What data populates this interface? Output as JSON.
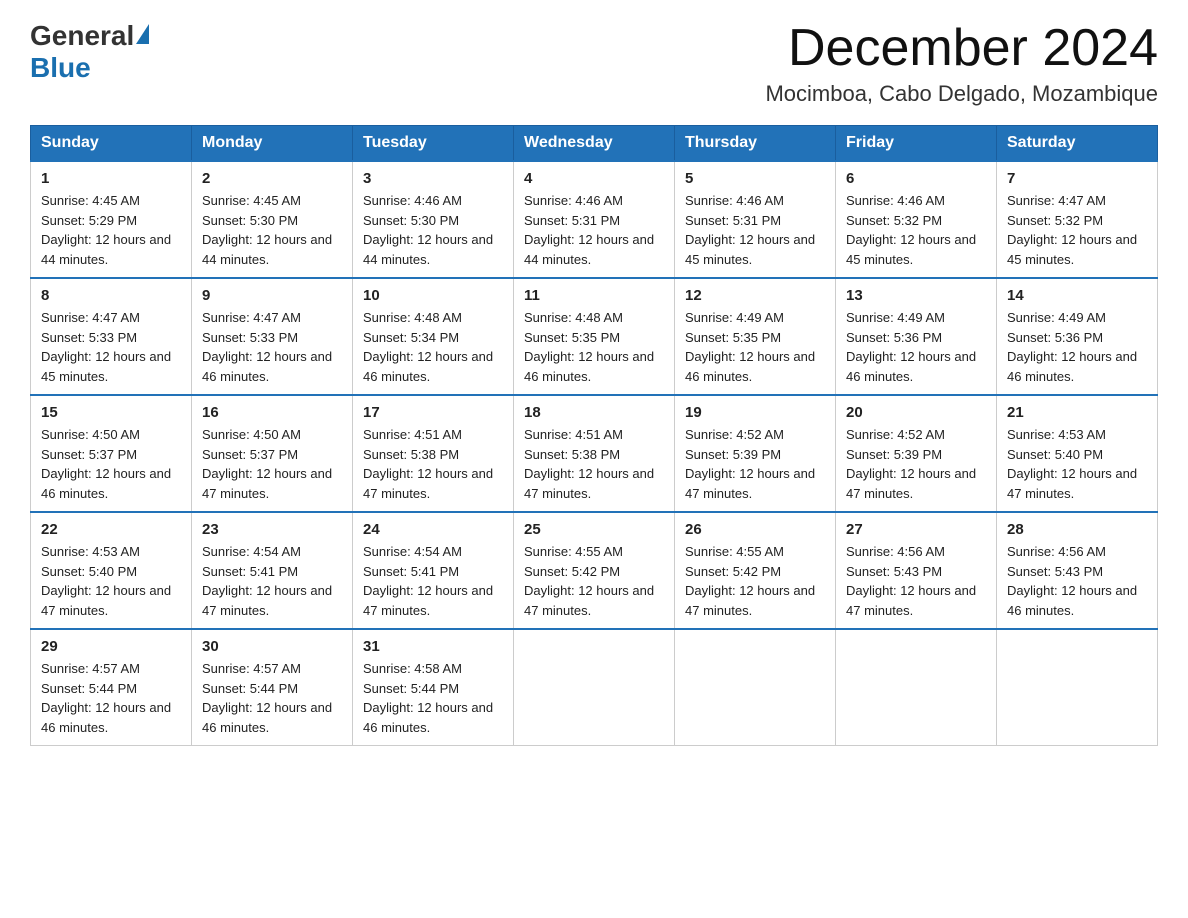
{
  "header": {
    "logo_general": "General",
    "logo_blue": "Blue",
    "month_title": "December 2024",
    "location": "Mocimboa, Cabo Delgado, Mozambique"
  },
  "weekdays": [
    "Sunday",
    "Monday",
    "Tuesday",
    "Wednesday",
    "Thursday",
    "Friday",
    "Saturday"
  ],
  "weeks": [
    [
      {
        "day": "1",
        "sunrise": "4:45 AM",
        "sunset": "5:29 PM",
        "daylight": "12 hours and 44 minutes."
      },
      {
        "day": "2",
        "sunrise": "4:45 AM",
        "sunset": "5:30 PM",
        "daylight": "12 hours and 44 minutes."
      },
      {
        "day": "3",
        "sunrise": "4:46 AM",
        "sunset": "5:30 PM",
        "daylight": "12 hours and 44 minutes."
      },
      {
        "day": "4",
        "sunrise": "4:46 AM",
        "sunset": "5:31 PM",
        "daylight": "12 hours and 44 minutes."
      },
      {
        "day": "5",
        "sunrise": "4:46 AM",
        "sunset": "5:31 PM",
        "daylight": "12 hours and 45 minutes."
      },
      {
        "day": "6",
        "sunrise": "4:46 AM",
        "sunset": "5:32 PM",
        "daylight": "12 hours and 45 minutes."
      },
      {
        "day": "7",
        "sunrise": "4:47 AM",
        "sunset": "5:32 PM",
        "daylight": "12 hours and 45 minutes."
      }
    ],
    [
      {
        "day": "8",
        "sunrise": "4:47 AM",
        "sunset": "5:33 PM",
        "daylight": "12 hours and 45 minutes."
      },
      {
        "day": "9",
        "sunrise": "4:47 AM",
        "sunset": "5:33 PM",
        "daylight": "12 hours and 46 minutes."
      },
      {
        "day": "10",
        "sunrise": "4:48 AM",
        "sunset": "5:34 PM",
        "daylight": "12 hours and 46 minutes."
      },
      {
        "day": "11",
        "sunrise": "4:48 AM",
        "sunset": "5:35 PM",
        "daylight": "12 hours and 46 minutes."
      },
      {
        "day": "12",
        "sunrise": "4:49 AM",
        "sunset": "5:35 PM",
        "daylight": "12 hours and 46 minutes."
      },
      {
        "day": "13",
        "sunrise": "4:49 AM",
        "sunset": "5:36 PM",
        "daylight": "12 hours and 46 minutes."
      },
      {
        "day": "14",
        "sunrise": "4:49 AM",
        "sunset": "5:36 PM",
        "daylight": "12 hours and 46 minutes."
      }
    ],
    [
      {
        "day": "15",
        "sunrise": "4:50 AM",
        "sunset": "5:37 PM",
        "daylight": "12 hours and 46 minutes."
      },
      {
        "day": "16",
        "sunrise": "4:50 AM",
        "sunset": "5:37 PM",
        "daylight": "12 hours and 47 minutes."
      },
      {
        "day": "17",
        "sunrise": "4:51 AM",
        "sunset": "5:38 PM",
        "daylight": "12 hours and 47 minutes."
      },
      {
        "day": "18",
        "sunrise": "4:51 AM",
        "sunset": "5:38 PM",
        "daylight": "12 hours and 47 minutes."
      },
      {
        "day": "19",
        "sunrise": "4:52 AM",
        "sunset": "5:39 PM",
        "daylight": "12 hours and 47 minutes."
      },
      {
        "day": "20",
        "sunrise": "4:52 AM",
        "sunset": "5:39 PM",
        "daylight": "12 hours and 47 minutes."
      },
      {
        "day": "21",
        "sunrise": "4:53 AM",
        "sunset": "5:40 PM",
        "daylight": "12 hours and 47 minutes."
      }
    ],
    [
      {
        "day": "22",
        "sunrise": "4:53 AM",
        "sunset": "5:40 PM",
        "daylight": "12 hours and 47 minutes."
      },
      {
        "day": "23",
        "sunrise": "4:54 AM",
        "sunset": "5:41 PM",
        "daylight": "12 hours and 47 minutes."
      },
      {
        "day": "24",
        "sunrise": "4:54 AM",
        "sunset": "5:41 PM",
        "daylight": "12 hours and 47 minutes."
      },
      {
        "day": "25",
        "sunrise": "4:55 AM",
        "sunset": "5:42 PM",
        "daylight": "12 hours and 47 minutes."
      },
      {
        "day": "26",
        "sunrise": "4:55 AM",
        "sunset": "5:42 PM",
        "daylight": "12 hours and 47 minutes."
      },
      {
        "day": "27",
        "sunrise": "4:56 AM",
        "sunset": "5:43 PM",
        "daylight": "12 hours and 47 minutes."
      },
      {
        "day": "28",
        "sunrise": "4:56 AM",
        "sunset": "5:43 PM",
        "daylight": "12 hours and 46 minutes."
      }
    ],
    [
      {
        "day": "29",
        "sunrise": "4:57 AM",
        "sunset": "5:44 PM",
        "daylight": "12 hours and 46 minutes."
      },
      {
        "day": "30",
        "sunrise": "4:57 AM",
        "sunset": "5:44 PM",
        "daylight": "12 hours and 46 minutes."
      },
      {
        "day": "31",
        "sunrise": "4:58 AM",
        "sunset": "5:44 PM",
        "daylight": "12 hours and 46 minutes."
      },
      null,
      null,
      null,
      null
    ]
  ]
}
